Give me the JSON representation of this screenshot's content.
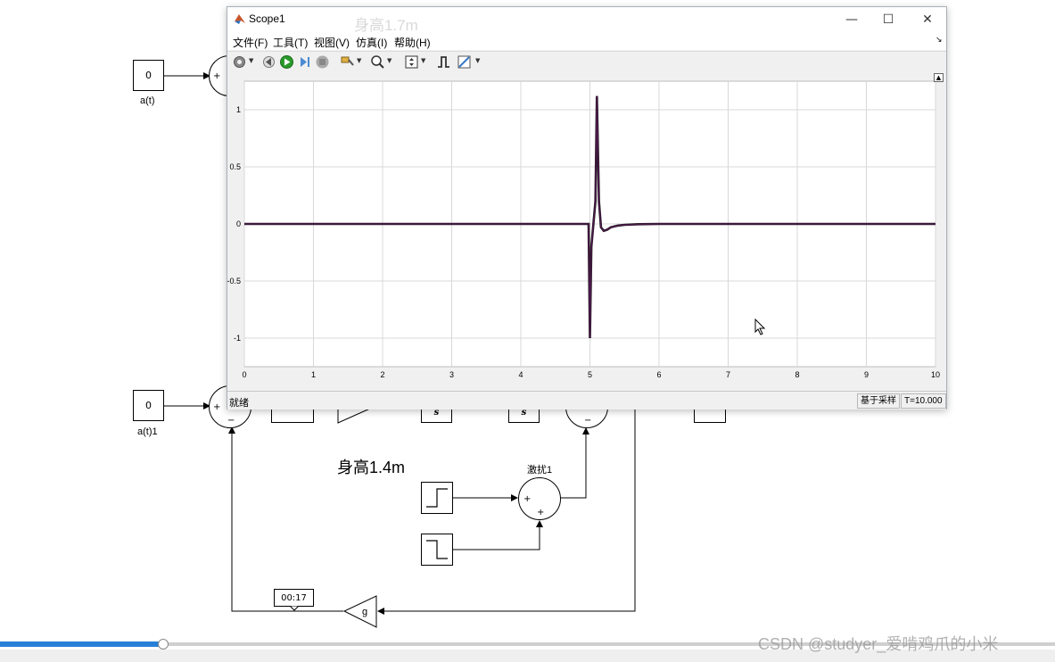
{
  "diagram": {
    "top_const_value": "0",
    "top_const_label": "a(t)",
    "bottom_const_value": "0",
    "bottom_const_label": "a(t)1",
    "height_label": "身高1.4m",
    "ghost_height_label": "身高1.7m",
    "disturb_label": "激扰1",
    "integrator_a": "s",
    "integrator_b": "s",
    "gain_label": "g",
    "sum_plus": "+",
    "sum_minus": "−"
  },
  "scope": {
    "title": "Scope1",
    "menu": [
      "文件(F)",
      "工具(T)",
      "视图(V)",
      "仿真(I)",
      "帮助(H)"
    ],
    "status_left": "就绪",
    "status_mode": "基于采样",
    "status_time": "T=10.000",
    "colors": {
      "trace": "#4a1848",
      "trace2": "#1a1a1a",
      "grid": "#d8d8d8"
    }
  },
  "chart_data": {
    "type": "line",
    "xlim": [
      0,
      10
    ],
    "ylim": [
      -1.25,
      1.25
    ],
    "x_ticks": [
      0,
      1,
      2,
      3,
      4,
      5,
      6,
      7,
      8,
      9,
      10
    ],
    "y_ticks": [
      1,
      0.5,
      0,
      -0.5,
      -1
    ],
    "y_tick_labels": [
      "1",
      "0.5",
      "0",
      "-0.5",
      "-1"
    ],
    "grid": true,
    "series": [
      {
        "x": [
          0,
          4.98,
          5.0,
          5.02,
          5.05,
          5.08,
          5.1,
          5.13,
          5.16,
          5.2,
          5.25,
          5.3,
          5.4,
          5.5,
          5.7,
          6.0,
          10
        ],
        "y": [
          0,
          0,
          -1.0,
          -0.2,
          0.0,
          0.2,
          1.12,
          0.2,
          -0.03,
          -0.06,
          -0.05,
          -0.03,
          -0.015,
          -0.008,
          -0.002,
          0,
          0
        ]
      }
    ]
  },
  "timestamp": "00:17",
  "watermark": "CSDN @studyer_爱啃鸡爪的小米",
  "progress": 0.155
}
